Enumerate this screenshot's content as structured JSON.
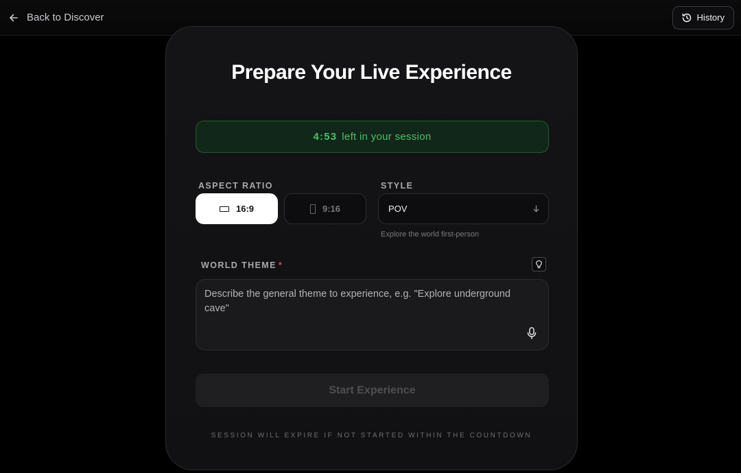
{
  "topbar": {
    "back_label": "Back to Discover",
    "history_label": "History"
  },
  "card": {
    "title": "Prepare Your Live Experience",
    "timer": {
      "time": "4:53",
      "suffix": "left in your session"
    },
    "aspect_ratio": {
      "label": "ASPECT RATIO",
      "options": [
        {
          "label": "16:9",
          "selected": true
        },
        {
          "label": "9:16",
          "selected": false
        }
      ]
    },
    "style": {
      "label": "STYLE",
      "selected": "POV",
      "hint": "Explore the world first-person"
    },
    "world_theme": {
      "label": "WORLD THEME",
      "required_mark": "*",
      "placeholder": "Describe the general theme to experience, e.g. \"Explore underground cave\""
    },
    "start_label": "Start Experience",
    "footnote": "SESSION WILL EXPIRE IF NOT STARTED WITHIN THE COUNTDOWN"
  },
  "colors": {
    "timer_text": "#4dc066",
    "timer_bg": "#10271a",
    "required": "#e0424a"
  }
}
